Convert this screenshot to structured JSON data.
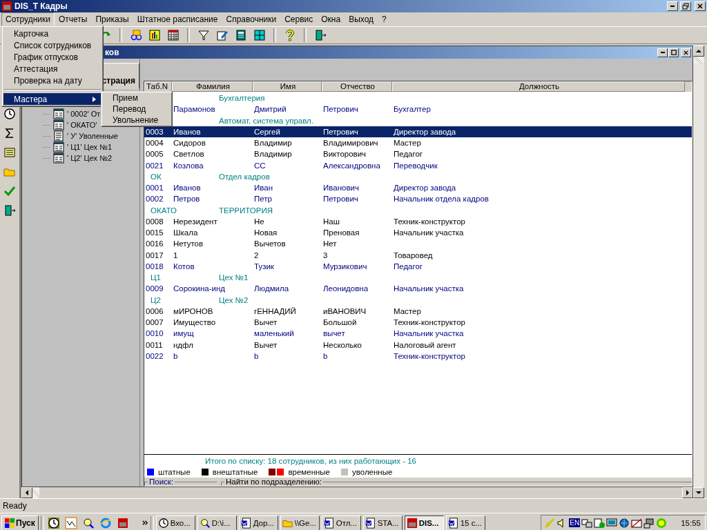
{
  "window": {
    "title": "DIS_T Кадры"
  },
  "menu": [
    {
      "label": "Сотрудники",
      "selected": true
    },
    {
      "label": "Отчеты",
      "selected": false
    },
    {
      "label": "Приказы",
      "selected": false
    },
    {
      "label": "Штатное расписание",
      "selected": false
    },
    {
      "label": "Справочники",
      "selected": false
    },
    {
      "label": "Сервис",
      "selected": false
    },
    {
      "label": "Окна",
      "selected": false
    },
    {
      "label": "Выход",
      "selected": false
    },
    {
      "label": "?",
      "selected": false
    }
  ],
  "dropdown": [
    {
      "label": "Карточка",
      "kind": "item",
      "selected": false
    },
    {
      "label": "Список сотрудников",
      "kind": "item",
      "selected": false
    },
    {
      "label": "График отпусков",
      "kind": "item",
      "selected": false
    },
    {
      "label": "Аттестация",
      "kind": "item",
      "selected": false
    },
    {
      "label": "Проверка на дату",
      "kind": "item",
      "selected": false
    },
    {
      "label": "Мастера",
      "kind": "submenu",
      "selected": true
    }
  ],
  "submenu": [
    {
      "label": "Прием"
    },
    {
      "label": "Перевод"
    },
    {
      "label": "Увольнение"
    }
  ],
  "child_window": {
    "title": "ков"
  },
  "tree": {
    "tab": "страция",
    "items": [
      {
        "label": "' 0002' От",
        "kind": "unit"
      },
      {
        "label": "' ОКАТО'",
        "kind": "unit"
      },
      {
        "label": "' У' Уволенные",
        "kind": "list"
      },
      {
        "label": "' Ц1' Цех №1",
        "kind": "unit"
      },
      {
        "label": "' Ц2' Цех №2",
        "kind": "unit"
      }
    ]
  },
  "table": {
    "columns": [
      "Таб.N",
      "Фамилия",
      "Имя",
      "Отчество",
      "Должность"
    ],
    "rows": [
      {
        "kind": "group",
        "name": "Бухгалтерия"
      },
      {
        "kind": "employee",
        "color": "#000080",
        "selected": false,
        "cells": [
          "",
          "Парамонов",
          "Дмитрий",
          "Петрович",
          "Бухгалтер"
        ]
      },
      {
        "kind": "group",
        "name": "Автомат. система управл."
      },
      {
        "kind": "employee",
        "selected": true,
        "cells": [
          "0003",
          "Иванов",
          "Сергей",
          "Петрович",
          "Директор завода"
        ]
      },
      {
        "kind": "employee",
        "color": "#000000",
        "selected": false,
        "cells": [
          "0004",
          "Сидоров",
          "Владимир",
          "Владимирович",
          "Мастер"
        ]
      },
      {
        "kind": "employee",
        "color": "#000000",
        "selected": false,
        "cells": [
          "0005",
          "Светлов",
          "Владимир",
          "Викторович",
          "Педагог"
        ]
      },
      {
        "kind": "employee",
        "color": "#000080",
        "selected": false,
        "cells": [
          "0021",
          "Козлова",
          "СС",
          "Александровна",
          "Переводчик"
        ]
      },
      {
        "kind": "group",
        "code": "ОК",
        "name": "Отдел кадров"
      },
      {
        "kind": "employee",
        "color": "#000080",
        "selected": false,
        "cells": [
          "0001",
          "Иванов",
          "Иван",
          "Иванович",
          "Директор завода"
        ]
      },
      {
        "kind": "employee",
        "color": "#000080",
        "selected": false,
        "cells": [
          "0002",
          "Петров",
          "Петр",
          "Петрович",
          "Начальник отдела кадров"
        ]
      },
      {
        "kind": "group",
        "code": "ОКАТО",
        "name": "ТЕРРИТОРИЯ"
      },
      {
        "kind": "employee",
        "color": "#000000",
        "selected": false,
        "cells": [
          "0008",
          "Нерезидент",
          "Не",
          "Наш",
          "Техник-конструктор"
        ]
      },
      {
        "kind": "employee",
        "color": "#000000",
        "selected": false,
        "cells": [
          "0015",
          "Шкала",
          "Новая",
          "Преновая",
          "Начальник участка"
        ]
      },
      {
        "kind": "employee",
        "color": "#000000",
        "selected": false,
        "cells": [
          "0016",
          "Нетутов",
          "Вычетов",
          "Нет",
          ""
        ]
      },
      {
        "kind": "employee",
        "color": "#000000",
        "selected": false,
        "cells": [
          "0017",
          "1",
          "2",
          "3",
          "Товаровед"
        ]
      },
      {
        "kind": "employee",
        "color": "#000080",
        "selected": false,
        "cells": [
          "0018",
          "Котов",
          "Тузик",
          "Мурзикович",
          "Педагог"
        ]
      },
      {
        "kind": "group",
        "code": "Ц1",
        "name": "Цех №1"
      },
      {
        "kind": "employee",
        "color": "#000080",
        "selected": false,
        "cells": [
          "0009",
          "Сорокина-инд",
          "Людмила",
          "Леонидовна",
          "Начальник участка"
        ]
      },
      {
        "kind": "group",
        "code": "Ц2",
        "name": "Цех №2"
      },
      {
        "kind": "employee",
        "color": "#000000",
        "selected": false,
        "cells": [
          "0006",
          "мИРОНОВ",
          "гЕННАДИЙ",
          "иВАНОВИЧ",
          "Мастер"
        ]
      },
      {
        "kind": "employee",
        "color": "#000000",
        "selected": false,
        "cells": [
          "0007",
          "Имущество",
          "Вычет",
          "Большой",
          "Техник-конструктор"
        ]
      },
      {
        "kind": "employee",
        "color": "#000080",
        "selected": false,
        "cells": [
          "0010",
          "имущ",
          "маленький",
          "вычет",
          "Начальник участка"
        ]
      },
      {
        "kind": "employee",
        "color": "#000000",
        "selected": false,
        "cells": [
          "0011",
          "ндфл",
          "Вычет",
          "Несколько",
          "Налоговый агент"
        ]
      },
      {
        "kind": "employee",
        "color": "#000080",
        "selected": false,
        "cells": [
          "0022",
          "b",
          "b",
          "b",
          "Техник-конструктор"
        ]
      }
    ]
  },
  "summary": "Итого по списку: 18 сотрудников, из них работающих - 16",
  "legend": [
    {
      "label": "штатные",
      "swatches": [
        {
          "color": "#0000ff"
        }
      ]
    },
    {
      "label": "внештатные",
      "swatches": [
        {
          "color": "#000000"
        }
      ]
    },
    {
      "label": "временные",
      "swatches": [
        {
          "color": "#800000"
        },
        {
          "color": "#ff0000"
        }
      ]
    },
    {
      "label": "уволенные",
      "swatches": [
        {
          "color": "#c0c0c0"
        }
      ]
    }
  ],
  "search": {
    "label": "Поиск:"
  },
  "dept_search": {
    "label": "Найти по подразделению:"
  },
  "status_bar": "Ready",
  "taskbar": {
    "start": "Пуск",
    "tasks": [
      {
        "label": "Вхо...",
        "selected": false
      },
      {
        "label": "D:\\i...",
        "selected": false
      },
      {
        "label": "Дор...",
        "selected": false
      },
      {
        "label": "\\\\Ge...",
        "selected": false
      },
      {
        "label": "Отл...",
        "selected": false
      },
      {
        "label": "STA...",
        "selected": false
      },
      {
        "label": "DIS...",
        "selected": true
      },
      {
        "label": "15 с...",
        "selected": false
      }
    ],
    "clock": "15:55",
    "lang": "EN"
  }
}
